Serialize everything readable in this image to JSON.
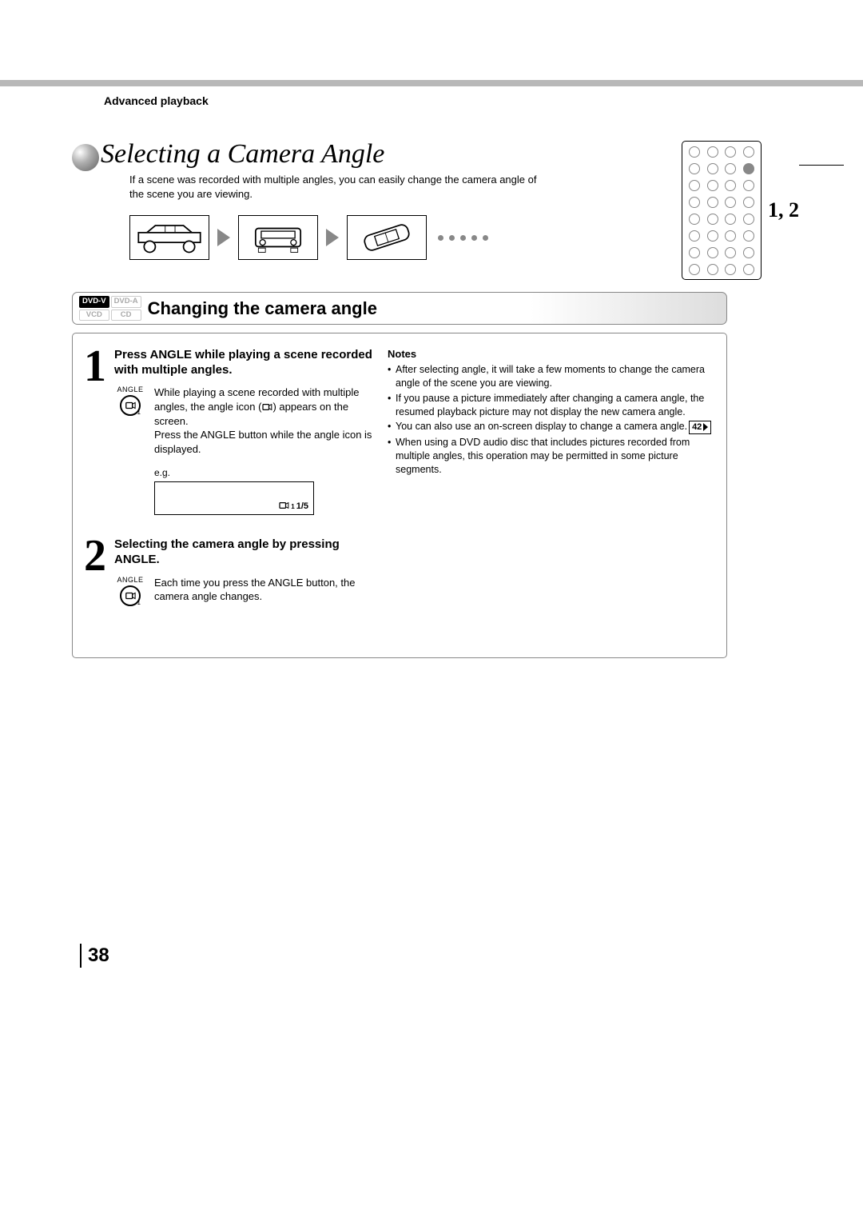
{
  "breadcrumb": "Advanced playback",
  "title": "Selecting a Camera Angle",
  "intro": "If a scene was recorded with multiple angles, you can easily change the camera angle of the scene you are viewing.",
  "remote_label": "1, 2",
  "badges": {
    "dvdv": "DVD-V",
    "dvda": "DVD-A",
    "vcd": "VCD",
    "cd": "CD"
  },
  "section_title": "Changing the camera angle",
  "step1": {
    "num": "1",
    "head": "Press ANGLE while playing a scene recorded with multiple angles.",
    "btn_label": "ANGLE",
    "body_a": "While playing a scene recorded with multiple angles, the angle icon (",
    "body_b": ") appears on the screen.",
    "body_c": "Press the ANGLE button while the angle icon is displayed.",
    "eg_label": "e.g.",
    "osd": "1/5"
  },
  "step2": {
    "num": "2",
    "head": "Selecting the camera angle by pressing ANGLE.",
    "btn_label": "ANGLE",
    "body": "Each time you press the ANGLE button, the camera angle changes."
  },
  "notes_head": "Notes",
  "notes": {
    "n1": "After selecting angle, it will take a few moments to change the camera angle of the scene you are viewing.",
    "n2": "If you pause a picture immediately after changing a camera angle, the resumed playback picture may not display the new camera angle.",
    "n3a": "You can also use an on-screen display to change a camera angle.",
    "n3ref": "42",
    "n4": "When using a DVD audio disc that includes pictures recorded from multiple angles, this operation may be permitted in some picture segments."
  },
  "page_number": "38"
}
